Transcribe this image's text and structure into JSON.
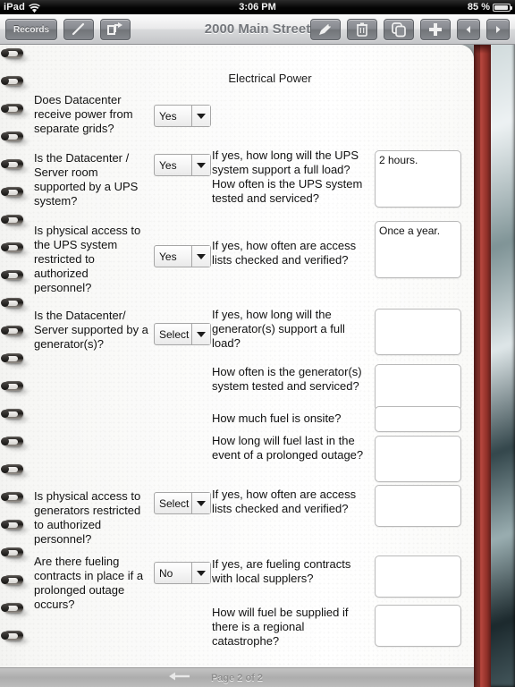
{
  "status_bar": {
    "device": "iPad",
    "wifi_icon": "wifi-icon",
    "time": "3:06 PM",
    "battery_percent": "85 %",
    "battery_icon": "battery-icon"
  },
  "toolbar": {
    "records_label": "Records",
    "pen_icon": "pen-icon",
    "share_icon": "share-export-icon",
    "title": "2000 Main Street",
    "edit_icon": "tag-pen-icon",
    "delete_icon": "trash-icon",
    "duplicate_icon": "copy-icon",
    "add_icon": "plus-icon",
    "prev_icon": "left-arrow-icon",
    "next_icon": "right-arrow-icon"
  },
  "form": {
    "title": "Electrical Power",
    "rows": [
      {
        "question": "Does Datacenter receive power from separate grids?",
        "select_value": "Yes"
      },
      {
        "question": "Is the Datacenter / Server room supported by a UPS system?",
        "select_value": "Yes",
        "sub_question": "If yes, how long will the UPS system support a full load? How often is the UPS system tested and serviced?",
        "answer": "2 hours."
      },
      {
        "question": "Is physical access to the UPS system restricted to authorized personnel?",
        "select_value": "Yes",
        "sub_question": "If yes, how often are access lists checked and verified?",
        "answer": "Once a year."
      },
      {
        "question": "Is the Datacenter/ Server supported by a generator(s)?",
        "select_value": "Select",
        "sub_question": "If yes, how long will the generator(s) support a full load?",
        "answer": ""
      },
      {
        "sub_question": "How often is the generator(s) system tested and serviced?",
        "answer": ""
      },
      {
        "sub_question": "How much fuel is onsite?",
        "answer": ""
      },
      {
        "sub_question": "How long will fuel last in the event of a prolonged outage?",
        "answer": ""
      },
      {
        "question": "Is physical access to generators restricted to authorized personnel?",
        "select_value": "Select",
        "sub_question": "If yes, how often are access lists checked and verified?",
        "answer": ""
      },
      {
        "question": "Are there fueling contracts in place if a prolonged outage occurs?",
        "select_value": "No",
        "sub_question": "If yes, are fueling contracts with local supplers?",
        "answer": ""
      },
      {
        "sub_question": "How will fuel be supplied if there is a regional catastrophe?",
        "answer": ""
      }
    ]
  },
  "page_bar": {
    "back_icon": "back-arrow-icon",
    "label": "Page 2 of 2"
  }
}
